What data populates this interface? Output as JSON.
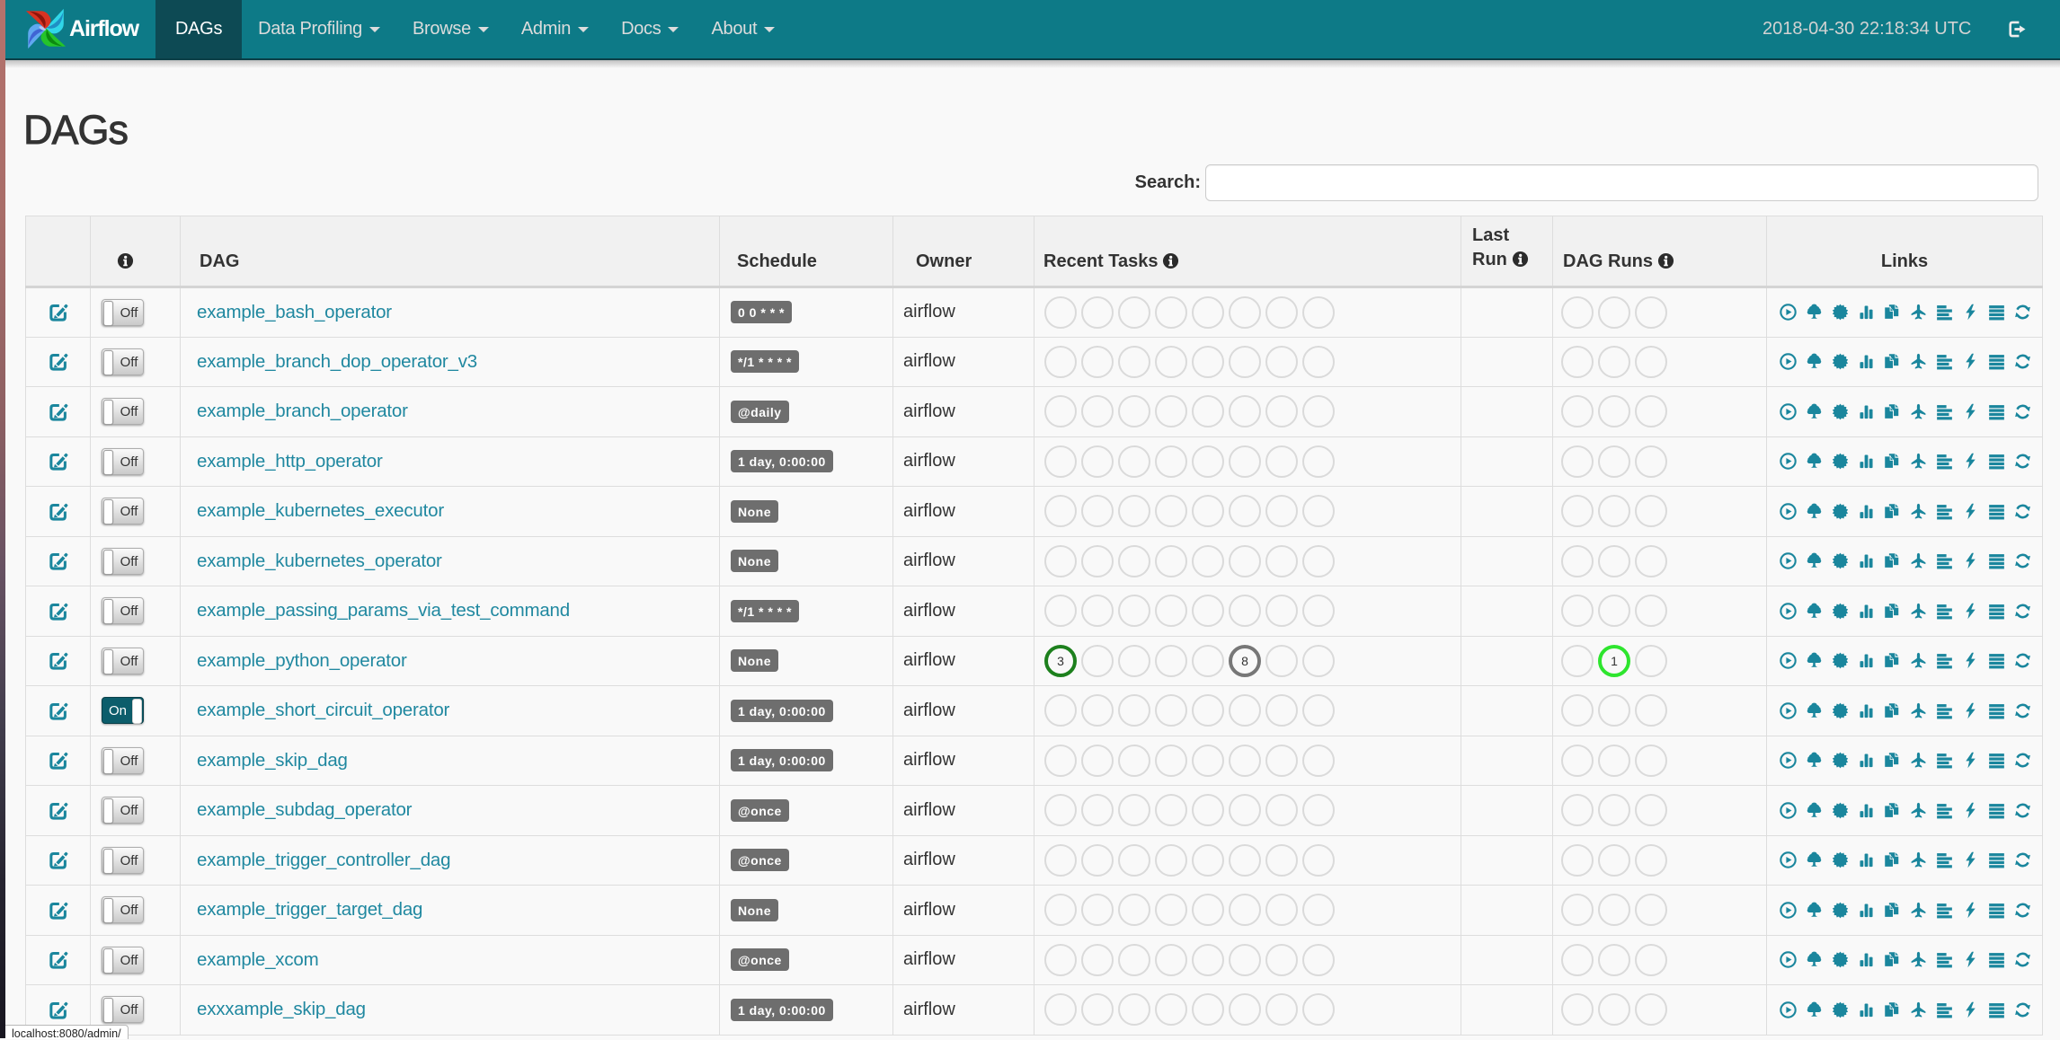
{
  "navbar": {
    "brand": "Airflow",
    "items": [
      {
        "label": "DAGs",
        "active": true,
        "caret": false
      },
      {
        "label": "Data Profiling",
        "active": false,
        "caret": true
      },
      {
        "label": "Browse",
        "active": false,
        "caret": true
      },
      {
        "label": "Admin",
        "active": false,
        "caret": true
      },
      {
        "label": "Docs",
        "active": false,
        "caret": true
      },
      {
        "label": "About",
        "active": false,
        "caret": true
      }
    ],
    "clock": "2018-04-30 22:18:34 UTC",
    "signout_icon": "sign-out-icon"
  },
  "page": {
    "title": "DAGs",
    "search_label": "Search:",
    "search_value": "",
    "status_tooltip": "localhost:8080/admin/"
  },
  "table": {
    "headers": {
      "edit": "",
      "info_icon": "info-icon",
      "dag": "DAG",
      "schedule": "Schedule",
      "owner": "Owner",
      "recent_tasks": "Recent Tasks",
      "last_run": "Last Run",
      "dag_runs": "DAG Runs",
      "links": "Links"
    },
    "recent_task_slots": 8,
    "dag_run_slots": 3,
    "links_icons": [
      "trigger-dag-icon",
      "tree-view-icon",
      "graph-view-icon",
      "task-duration-icon",
      "task-tries-icon",
      "landing-times-icon",
      "gantt-icon",
      "code-view-icon",
      "dag-details-icon",
      "refresh-icon"
    ],
    "rows": [
      {
        "dag_id": "example_bash_operator",
        "toggle": "Off",
        "schedule": "0 0 * * *",
        "owner": "airflow",
        "recent_tasks": [],
        "last_run": "",
        "dag_runs": []
      },
      {
        "dag_id": "example_branch_dop_operator_v3",
        "toggle": "Off",
        "schedule": "*/1 * * * *",
        "owner": "airflow",
        "recent_tasks": [],
        "last_run": "",
        "dag_runs": []
      },
      {
        "dag_id": "example_branch_operator",
        "toggle": "Off",
        "schedule": "@daily",
        "owner": "airflow",
        "recent_tasks": [],
        "last_run": "",
        "dag_runs": []
      },
      {
        "dag_id": "example_http_operator",
        "toggle": "Off",
        "schedule": "1 day, 0:00:00",
        "owner": "airflow",
        "recent_tasks": [],
        "last_run": "",
        "dag_runs": []
      },
      {
        "dag_id": "example_kubernetes_executor",
        "toggle": "Off",
        "schedule": "None",
        "owner": "airflow",
        "recent_tasks": [],
        "last_run": "",
        "dag_runs": []
      },
      {
        "dag_id": "example_kubernetes_operator",
        "toggle": "Off",
        "schedule": "None",
        "owner": "airflow",
        "recent_tasks": [],
        "last_run": "",
        "dag_runs": []
      },
      {
        "dag_id": "example_passing_params_via_test_command",
        "toggle": "Off",
        "schedule": "*/1 * * * *",
        "owner": "airflow",
        "recent_tasks": [],
        "last_run": "",
        "dag_runs": []
      },
      {
        "dag_id": "example_python_operator",
        "toggle": "Off",
        "schedule": "None",
        "owner": "airflow",
        "recent_tasks": [
          {
            "slot": 1,
            "count": 3,
            "state": "success",
            "color": "#1d801d"
          },
          {
            "slot": 6,
            "count": 8,
            "state": "queued",
            "color": "#777777"
          }
        ],
        "last_run": "",
        "dag_runs": [
          {
            "slot": 2,
            "count": 1,
            "state": "running",
            "color": "#2ee52e"
          }
        ]
      },
      {
        "dag_id": "example_short_circuit_operator",
        "toggle": "On",
        "schedule": "1 day, 0:00:00",
        "owner": "airflow",
        "recent_tasks": [],
        "last_run": "",
        "dag_runs": []
      },
      {
        "dag_id": "example_skip_dag",
        "toggle": "Off",
        "schedule": "1 day, 0:00:00",
        "owner": "airflow",
        "recent_tasks": [],
        "last_run": "",
        "dag_runs": []
      },
      {
        "dag_id": "example_subdag_operator",
        "toggle": "Off",
        "schedule": "@once",
        "owner": "airflow",
        "recent_tasks": [],
        "last_run": "",
        "dag_runs": []
      },
      {
        "dag_id": "example_trigger_controller_dag",
        "toggle": "Off",
        "schedule": "@once",
        "owner": "airflow",
        "recent_tasks": [],
        "last_run": "",
        "dag_runs": []
      },
      {
        "dag_id": "example_trigger_target_dag",
        "toggle": "Off",
        "schedule": "None",
        "owner": "airflow",
        "recent_tasks": [],
        "last_run": "",
        "dag_runs": []
      },
      {
        "dag_id": "example_xcom",
        "toggle": "Off",
        "schedule": "@once",
        "owner": "airflow",
        "recent_tasks": [],
        "last_run": "",
        "dag_runs": []
      },
      {
        "dag_id": "exxxample_skip_dag",
        "toggle": "Off",
        "schedule": "1 day, 0:00:00",
        "owner": "airflow",
        "recent_tasks": [],
        "last_run": "",
        "dag_runs": []
      }
    ]
  },
  "colors": {
    "navbar_bg": "#0d7a87",
    "navbar_active_bg": "#0d4a54",
    "accent_teal": "#1a869d",
    "link_teal": "#2088a0",
    "badge_gray": "#6e6e6e",
    "toggle_on_bg": "#0c5d6b",
    "circle_empty_border": "#dadada",
    "state_success": "#1d801d",
    "state_running": "#2ee52e",
    "state_queued": "#777777"
  }
}
